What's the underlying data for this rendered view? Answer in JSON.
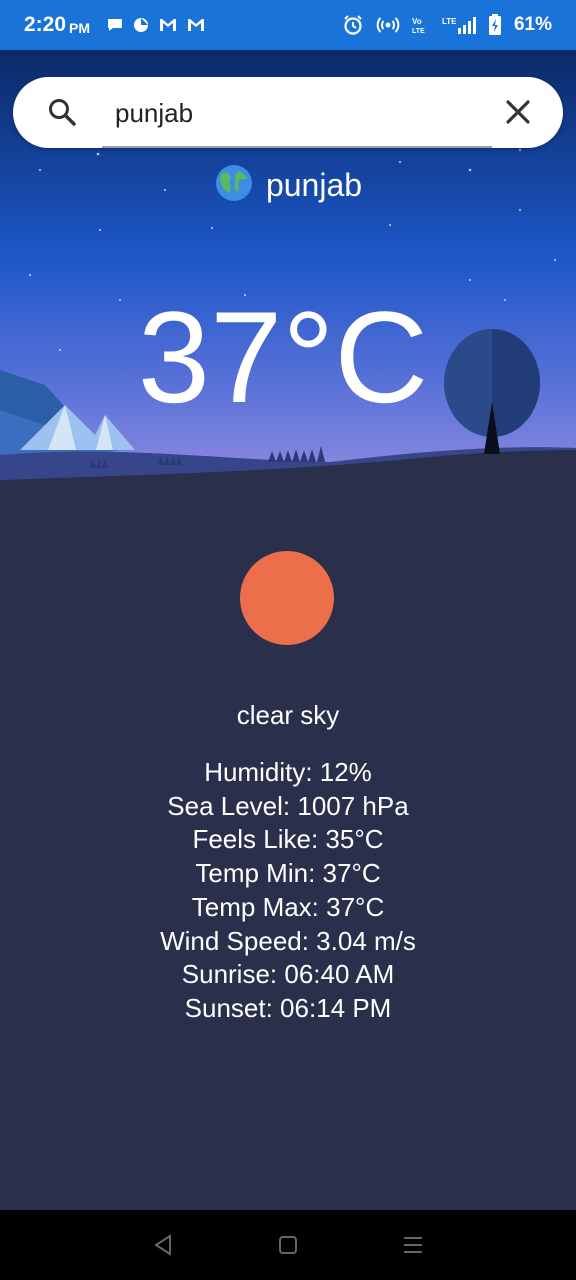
{
  "status_bar": {
    "time": "2:20",
    "ampm": "PM",
    "battery_percent": "61%",
    "left_icons": [
      "chat-icon",
      "app-icon",
      "gmail-icon",
      "gmail-icon"
    ],
    "right_icons": [
      "alarm-icon",
      "hotspot-icon",
      "volte-icon",
      "signal-icon",
      "battery-icon"
    ]
  },
  "search": {
    "value": "punjab",
    "placeholder": ""
  },
  "location": {
    "name": "punjab",
    "icon": "globe-icon"
  },
  "weather": {
    "temperature": "37°C",
    "icon": "sun-icon",
    "description": "clear sky",
    "details": [
      "Humidity: 12%",
      "Sea Level: 1007 hPa",
      "Feels Like: 35°C",
      "Temp Min: 37°C",
      "Temp Max: 37°C",
      "Wind Speed: 3.04 m/s",
      "Sunrise: 06:40 AM",
      "Sunset: 06:14 PM"
    ]
  },
  "colors": {
    "status_bar": "#1a73d8",
    "sky_top": "#0b2a66",
    "sky_bottom": "#8a8fe0",
    "ground": "#2a2f4b",
    "sun": "#ec6e4a"
  },
  "nav_bar": {
    "buttons": [
      "back-icon",
      "home-icon",
      "menu-icon"
    ]
  }
}
